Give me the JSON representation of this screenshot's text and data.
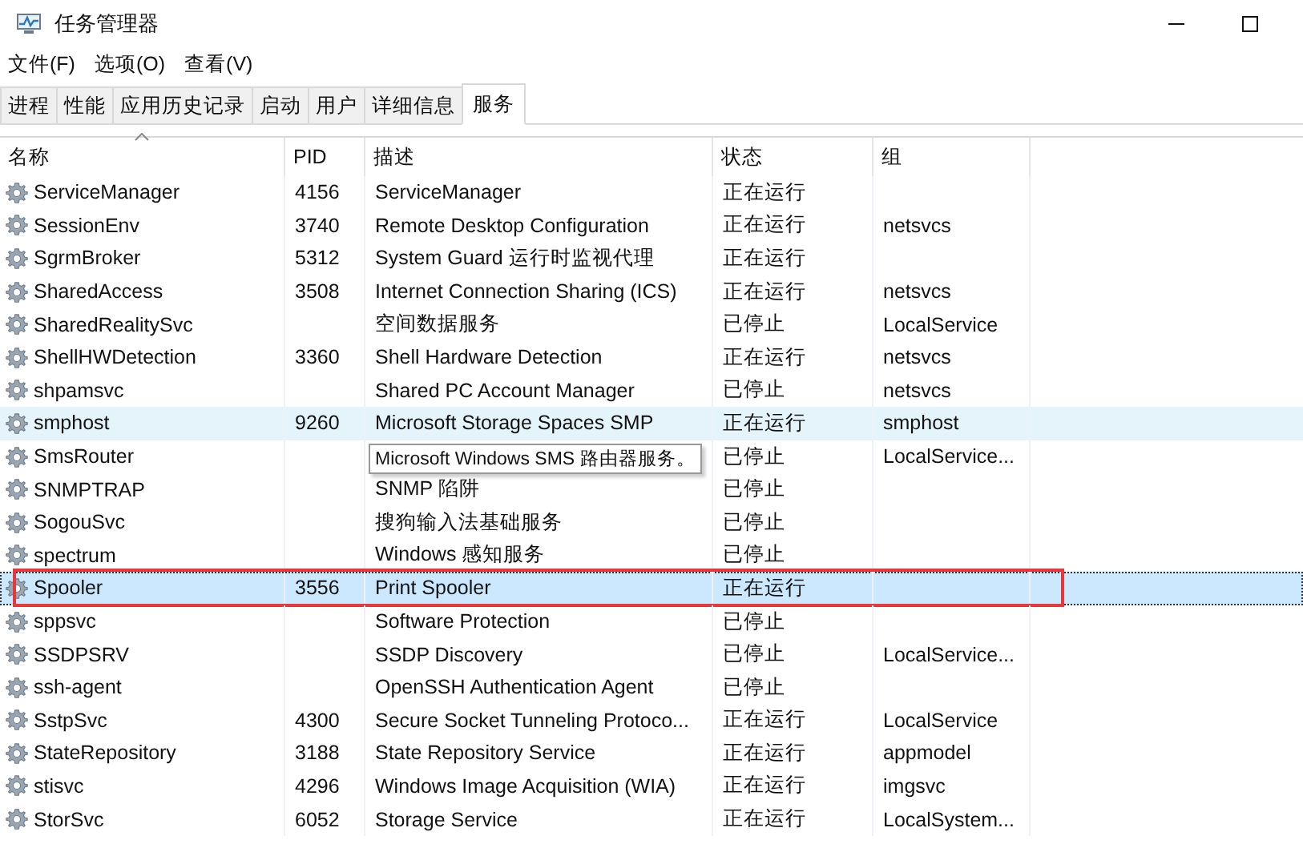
{
  "window": {
    "title": "任务管理器"
  },
  "menu": [
    "文件(F)",
    "选项(O)",
    "查看(V)"
  ],
  "tabs": [
    {
      "label": "进程",
      "selected": false
    },
    {
      "label": "性能",
      "selected": false
    },
    {
      "label": "应用历史记录",
      "selected": false
    },
    {
      "label": "启动",
      "selected": false
    },
    {
      "label": "用户",
      "selected": false
    },
    {
      "label": "详细信息",
      "selected": false
    },
    {
      "label": "服务",
      "selected": true
    }
  ],
  "table": {
    "columns": [
      {
        "label": "名称",
        "sorted": true
      },
      {
        "label": "PID",
        "sorted": false
      },
      {
        "label": "描述",
        "sorted": false
      },
      {
        "label": "状态",
        "sorted": false
      },
      {
        "label": "组",
        "sorted": false
      }
    ],
    "rows": [
      {
        "name": "ServiceManager",
        "pid": "4156",
        "description": "ServiceManager",
        "status": "正在运行",
        "selected": false,
        "hovered": false,
        "outlined": false
      },
      {
        "name": "SessionEnv",
        "pid": "3740",
        "description": "Remote Desktop Configuration",
        "status": "正在运行",
        "group": "netsvcs",
        "selected": false,
        "hovered": false,
        "outlined": false
      },
      {
        "name": "SgrmBroker",
        "pid": "5312",
        "description": "System Guard 运行时监视代理",
        "status": "正在运行",
        "selected": false,
        "hovered": false,
        "outlined": false
      },
      {
        "name": "SharedAccess",
        "pid": "3508",
        "description": "Internet Connection Sharing (ICS)",
        "status": "正在运行",
        "group": "netsvcs",
        "selected": false,
        "hovered": false,
        "outlined": false
      },
      {
        "name": "SharedRealitySvc",
        "description": "空间数据服务",
        "status": "已停止",
        "group": "LocalService",
        "selected": false,
        "hovered": false,
        "outlined": false
      },
      {
        "name": "ShellHWDetection",
        "pid": "3360",
        "description": "Shell Hardware Detection",
        "status": "正在运行",
        "group": "netsvcs",
        "selected": false,
        "hovered": false,
        "outlined": false
      },
      {
        "name": "shpamsvc",
        "description": "Shared PC Account Manager",
        "status": "已停止",
        "group": "netsvcs",
        "selected": false,
        "hovered": false,
        "outlined": false
      },
      {
        "name": "smphost",
        "pid": "9260",
        "description": "Microsoft Storage Spaces SMP",
        "status": "正在运行",
        "group": "smphost",
        "selected": false,
        "hovered": true,
        "outlined": false
      },
      {
        "name": "SmsRouter",
        "tooltip": "Microsoft Windows SMS 路由器服务。",
        "status": "已停止",
        "group": "LocalService...",
        "selected": false,
        "hovered": false,
        "outlined": false
      },
      {
        "name": "SNMPTRAP",
        "description": "SNMP 陷阱",
        "status": "已停止",
        "selected": false,
        "hovered": false,
        "outlined": false
      },
      {
        "name": "SogouSvc",
        "description": "搜狗输入法基础服务",
        "status": "已停止",
        "selected": false,
        "hovered": false,
        "outlined": false
      },
      {
        "name": "spectrum",
        "description": "Windows 感知服务",
        "status": "已停止",
        "selected": false,
        "hovered": false,
        "outlined": false
      },
      {
        "name": "Spooler",
        "pid": "3556",
        "description": "Print Spooler",
        "status": "正在运行",
        "selected": true,
        "hovered": false,
        "outlined": true
      },
      {
        "name": "sppsvc",
        "description": "Software Protection",
        "status": "已停止",
        "selected": false,
        "hovered": false,
        "outlined": false
      },
      {
        "name": "SSDPSRV",
        "description": "SSDP Discovery",
        "status": "已停止",
        "group": "LocalService...",
        "selected": false,
        "hovered": false,
        "outlined": false
      },
      {
        "name": "ssh-agent",
        "description": "OpenSSH Authentication Agent",
        "status": "已停止",
        "selected": false,
        "hovered": false,
        "outlined": false
      },
      {
        "name": "SstpSvc",
        "pid": "4300",
        "description": "Secure Socket Tunneling Protoco...",
        "status": "正在运行",
        "group": "LocalService",
        "selected": false,
        "hovered": false,
        "outlined": false
      },
      {
        "name": "StateRepository",
        "pid": "3188",
        "description": "State Repository Service",
        "status": "正在运行",
        "group": "appmodel",
        "selected": false,
        "hovered": false,
        "outlined": false
      },
      {
        "name": "stisvc",
        "pid": "4296",
        "description": "Windows Image Acquisition (WIA)",
        "status": "正在运行",
        "group": "imgsvc",
        "selected": false,
        "hovered": false,
        "outlined": false
      },
      {
        "name": "StorSvc",
        "pid": "6052",
        "description": "Storage Service",
        "status": "正在运行",
        "group": "LocalSystem...",
        "selected": false,
        "hovered": false,
        "outlined": false
      }
    ]
  }
}
